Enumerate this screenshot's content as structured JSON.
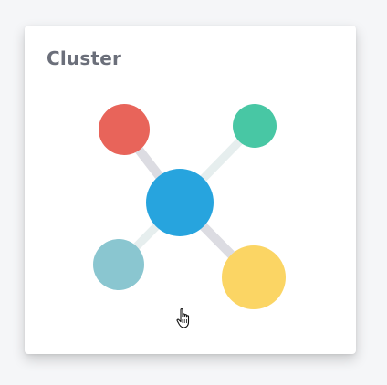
{
  "card": {
    "title": "Cluster"
  },
  "colors": {
    "center_node": "#27a4de",
    "top_left_node": "#e8645a",
    "top_right_node": "#48c7a4",
    "bottom_left_node": "#8ac6d0",
    "bottom_right_node": "#fbd564",
    "link_light": "#e6eeee",
    "link_gray": "#dcdce2"
  },
  "icons": {
    "illustration": "cluster-network-icon",
    "cursor": "hand-pointer-icon"
  }
}
